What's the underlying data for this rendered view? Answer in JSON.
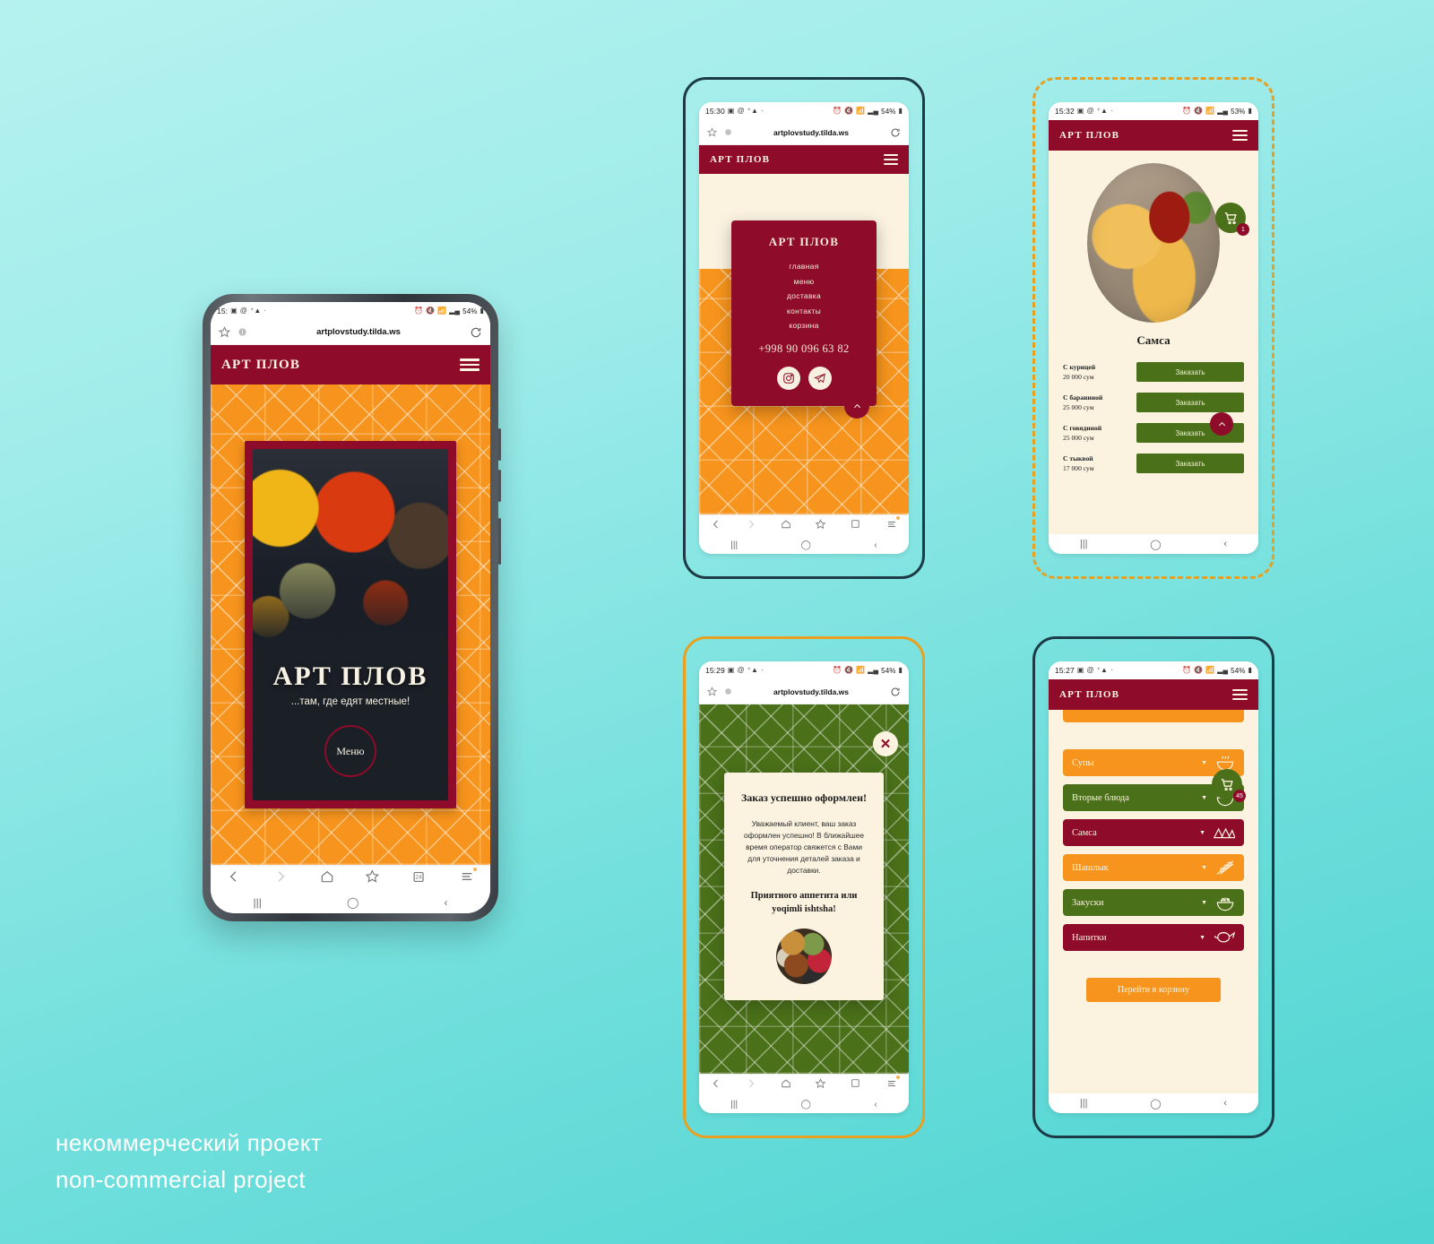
{
  "caption": {
    "line_ru": "некоммерческий проект",
    "line_en": "non-commercial project"
  },
  "brand": "АРТ ПЛОВ",
  "url": "artplovstudy.tilda.ws",
  "phones": {
    "main": {
      "status_time": "15:",
      "battery": "54%",
      "url": "artplovstudy.tilda.ws",
      "header_brand": "АРТ ПЛОВ",
      "hero_title": "АРТ ПЛОВ",
      "hero_subtitle": "...там, где едят местные!",
      "hero_button": "Меню"
    },
    "menu": {
      "status_time": "15:30",
      "battery": "54%",
      "url": "artplovstudy.tilda.ws",
      "header_brand": "АРТ ПЛОВ",
      "panel_title": "АРТ ПЛОВ",
      "links": [
        "главная",
        "меню",
        "доставка",
        "контакты",
        "корзина"
      ],
      "phone_number": "+998 90 096 63 82",
      "socials": [
        "instagram-icon",
        "telegram-icon"
      ],
      "scroll_top": "scroll-to-top-icon"
    },
    "samsa": {
      "status_time": "15:32",
      "battery": "53%",
      "header_brand": "АРТ ПЛОВ",
      "product_title": "Самса",
      "cart_count": "1",
      "items": [
        {
          "name": "С курицей",
          "price": "20 000 сум",
          "button": "Заказать"
        },
        {
          "name": "С бараниной",
          "price": "25 000 сум",
          "button": "Заказать"
        },
        {
          "name": "С говядиной",
          "price": "25 000 сум",
          "button": "Заказать"
        },
        {
          "name": "С тыквой",
          "price": "17 000 сум",
          "button": "Заказать"
        }
      ]
    },
    "success": {
      "status_time": "15:29",
      "battery": "54%",
      "url": "artplovstudy.tilda.ws",
      "heading": "Заказ успешно оформлен!",
      "body": "Уважаемый клиент, ваш заказ оформлен успешно! В ближайшее время оператор свяжется с Вами для уточнения деталей заказа и доставки.",
      "bon_appetit": "Приятного аппетита или yoqimli ishtsha!",
      "close": "close-icon"
    },
    "categories": {
      "status_time": "15:27",
      "battery": "54%",
      "header_brand": "АРТ ПЛОВ",
      "cart_count": "45",
      "items": [
        {
          "label": "Супы",
          "color": "#f6941d",
          "icon": "soup-bowl-icon"
        },
        {
          "label": "Вторые блюда",
          "color": "#4a7019",
          "icon": "rice-bowl-icon"
        },
        {
          "label": "Самса",
          "color": "#8e0b2a",
          "icon": "samsa-icon"
        },
        {
          "label": "Шашлык",
          "color": "#f6941d",
          "icon": "kebab-skewer-icon"
        },
        {
          "label": "Закуски",
          "color": "#4a7019",
          "icon": "salad-bowl-icon"
        },
        {
          "label": "Напитки",
          "color": "#8e0b2a",
          "icon": "teapot-icon"
        }
      ],
      "cart_button": "Перейти в корзину",
      "chevron": "▼"
    }
  },
  "colors": {
    "crimson": "#8e0b2a",
    "orange": "#f6941d",
    "green": "#4a7019",
    "cream": "#fbf3e0",
    "teal_bg": "#74e0dd"
  }
}
